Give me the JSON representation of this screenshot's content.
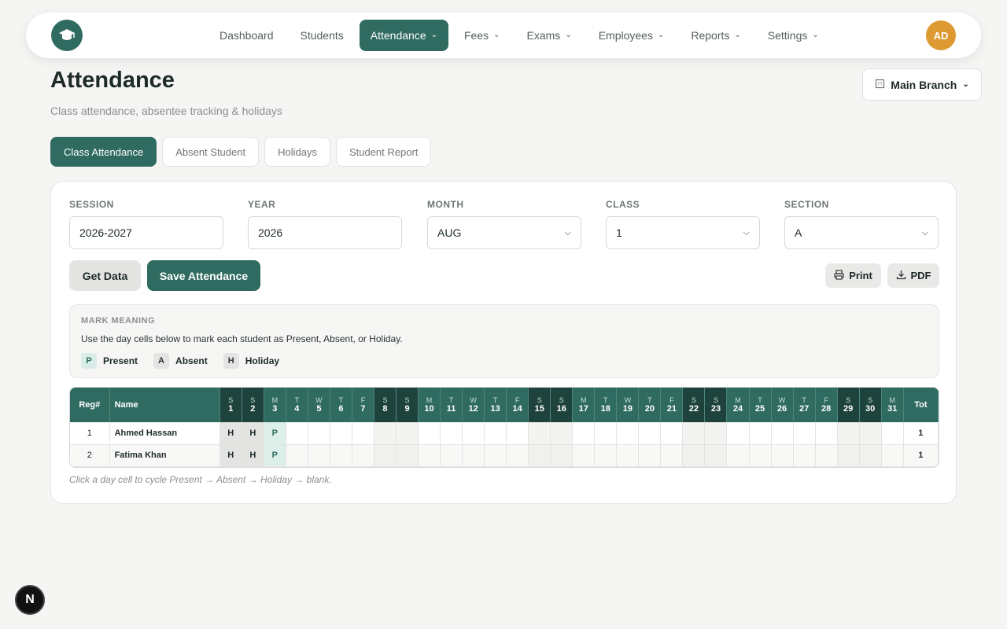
{
  "nav": {
    "items": [
      {
        "label": "Dashboard",
        "dropdown": false,
        "active": false
      },
      {
        "label": "Students",
        "dropdown": false,
        "active": false
      },
      {
        "label": "Attendance",
        "dropdown": true,
        "active": true
      },
      {
        "label": "Fees",
        "dropdown": true,
        "active": false
      },
      {
        "label": "Exams",
        "dropdown": true,
        "active": false
      },
      {
        "label": "Employees",
        "dropdown": true,
        "active": false
      },
      {
        "label": "Reports",
        "dropdown": true,
        "active": false
      },
      {
        "label": "Settings",
        "dropdown": true,
        "active": false
      }
    ],
    "avatar_initials": "AD"
  },
  "header": {
    "title": "Attendance",
    "subtitle": "Class attendance, absentee tracking & holidays",
    "branch_label": "Main Branch"
  },
  "tabs": [
    {
      "label": "Class Attendance",
      "active": true
    },
    {
      "label": "Absent Student",
      "active": false
    },
    {
      "label": "Holidays",
      "active": false
    },
    {
      "label": "Student Report",
      "active": false
    }
  ],
  "filters": {
    "session": {
      "label": "SESSION",
      "value": "2026-2027"
    },
    "year": {
      "label": "YEAR",
      "value": "2026"
    },
    "month": {
      "label": "MONTH",
      "value": "AUG"
    },
    "class": {
      "label": "CLASS",
      "value": "1"
    },
    "section": {
      "label": "SECTION",
      "value": "A"
    }
  },
  "actions": {
    "get_data": "Get Data",
    "save": "Save Attendance",
    "print": "Print",
    "pdf": "PDF"
  },
  "legend": {
    "title": "MARK MEANING",
    "text": "Use the day cells below to mark each student as Present, Absent, or Holiday.",
    "items": [
      {
        "code": "P",
        "label": "Present"
      },
      {
        "code": "A",
        "label": "Absent"
      },
      {
        "code": "H",
        "label": "Holiday"
      }
    ]
  },
  "grid": {
    "reg_header": "Reg#",
    "name_header": "Name",
    "total_header": "Tot",
    "days": [
      {
        "d": "S",
        "n": "1",
        "weekend": true
      },
      {
        "d": "S",
        "n": "2",
        "weekend": true
      },
      {
        "d": "M",
        "n": "3",
        "weekend": false
      },
      {
        "d": "T",
        "n": "4",
        "weekend": false
      },
      {
        "d": "W",
        "n": "5",
        "weekend": false
      },
      {
        "d": "T",
        "n": "6",
        "weekend": false
      },
      {
        "d": "F",
        "n": "7",
        "weekend": false
      },
      {
        "d": "S",
        "n": "8",
        "weekend": true
      },
      {
        "d": "S",
        "n": "9",
        "weekend": true
      },
      {
        "d": "M",
        "n": "10",
        "weekend": false
      },
      {
        "d": "T",
        "n": "11",
        "weekend": false
      },
      {
        "d": "W",
        "n": "12",
        "weekend": false
      },
      {
        "d": "T",
        "n": "13",
        "weekend": false
      },
      {
        "d": "F",
        "n": "14",
        "weekend": false
      },
      {
        "d": "S",
        "n": "15",
        "weekend": true
      },
      {
        "d": "S",
        "n": "16",
        "weekend": true
      },
      {
        "d": "M",
        "n": "17",
        "weekend": false
      },
      {
        "d": "T",
        "n": "18",
        "weekend": false
      },
      {
        "d": "W",
        "n": "19",
        "weekend": false
      },
      {
        "d": "T",
        "n": "20",
        "weekend": false
      },
      {
        "d": "F",
        "n": "21",
        "weekend": false
      },
      {
        "d": "S",
        "n": "22",
        "weekend": true
      },
      {
        "d": "S",
        "n": "23",
        "weekend": true
      },
      {
        "d": "M",
        "n": "24",
        "weekend": false
      },
      {
        "d": "T",
        "n": "25",
        "weekend": false
      },
      {
        "d": "W",
        "n": "26",
        "weekend": false
      },
      {
        "d": "T",
        "n": "27",
        "weekend": false
      },
      {
        "d": "F",
        "n": "28",
        "weekend": false
      },
      {
        "d": "S",
        "n": "29",
        "weekend": true
      },
      {
        "d": "S",
        "n": "30",
        "weekend": true
      },
      {
        "d": "M",
        "n": "31",
        "weekend": false
      }
    ],
    "rows": [
      {
        "reg": "1",
        "name": "Ahmed Hassan",
        "marks": [
          "H",
          "H",
          "P"
        ],
        "total": "1"
      },
      {
        "reg": "2",
        "name": "Fatima Khan",
        "marks": [
          "H",
          "H",
          "P"
        ],
        "total": "1"
      }
    ],
    "hint": "Click a day cell to cycle Present → Absent → Holiday → blank."
  },
  "colors": {
    "primary": "#2f6b60",
    "weekend_header": "#1e433d",
    "avatar": "#dc9a30"
  },
  "icons": {
    "logo": "graduation-cap-icon",
    "branch": "building-icon",
    "print": "printer-icon",
    "pdf": "download-icon"
  }
}
